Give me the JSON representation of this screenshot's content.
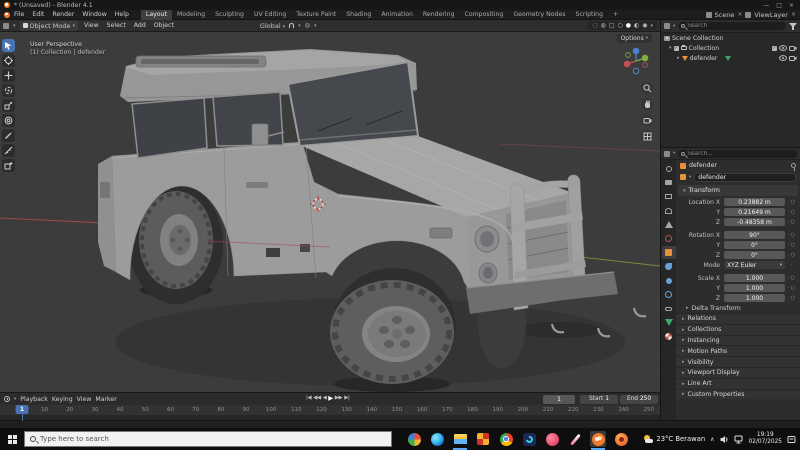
{
  "colors": {
    "accent": "#4772b3",
    "object_orange": "#e8913a",
    "data_green": "#3fa66f",
    "axis_x": "#a84a4f",
    "axis_y": "#7f9b39"
  },
  "window": {
    "title": "* (Unsaved) - Blender 4.1"
  },
  "topbar": {
    "menus": [
      "File",
      "Edit",
      "Render",
      "Window",
      "Help"
    ],
    "workspaces": [
      "Layout",
      "Modeling",
      "Sculpting",
      "UV Editing",
      "Texture Paint",
      "Shading",
      "Animation",
      "Rendering",
      "Compositing",
      "Geometry Nodes",
      "Scripting",
      "+"
    ],
    "scene_label": "Scene",
    "view_layer_label": "ViewLayer"
  },
  "tool_header": {
    "mode": "Object Mode",
    "menus": [
      "View",
      "Select",
      "Add",
      "Object"
    ],
    "orientation": "Global"
  },
  "viewport": {
    "overlay_line1": "User Perspective",
    "overlay_line2": "(1) Collection | defender",
    "options_label": "Options"
  },
  "outliner": {
    "search_placeholder": "Search",
    "rows": [
      {
        "label": "Scene Collection"
      },
      {
        "label": "Collection"
      },
      {
        "label": "defender"
      }
    ]
  },
  "properties": {
    "search_placeholder": "Search...",
    "breadcrumb_object": "defender",
    "name_value": "defender",
    "transform_title": "Transform",
    "rows": [
      {
        "label": "Location X",
        "value": "0.23882 m"
      },
      {
        "label": "Y",
        "value": "0.21649 m"
      },
      {
        "label": "Z",
        "value": "-0.48358 m"
      },
      {
        "label": "Rotation X",
        "value": "90°"
      },
      {
        "label": "Y",
        "value": "0°"
      },
      {
        "label": "Z",
        "value": "0°"
      },
      {
        "label": "Mode",
        "value": "XYZ Euler"
      },
      {
        "label": "Scale X",
        "value": "1.000"
      },
      {
        "label": "Y",
        "value": "1.000"
      },
      {
        "label": "Z",
        "value": "1.000"
      }
    ],
    "subsection": "Delta Transform",
    "sections": [
      "Relations",
      "Collections",
      "Instancing",
      "Motion Paths",
      "Visibility",
      "Viewport Display",
      "Line Art",
      "Custom Properties"
    ]
  },
  "timeline": {
    "menus": [
      "Playback",
      "Keying",
      "View",
      "Marker"
    ],
    "current_frame": "1",
    "start_label": "Start",
    "start_value": "1",
    "end_label": "End",
    "end_value": "250",
    "ticks": [
      1,
      10,
      20,
      30,
      40,
      50,
      60,
      70,
      80,
      90,
      100,
      110,
      120,
      130,
      140,
      150,
      160,
      170,
      180,
      190,
      200,
      210,
      220,
      230,
      240,
      250
    ]
  },
  "taskbar": {
    "search_placeholder": "Type here to search",
    "tray": {
      "weather": "23°C Berawan",
      "time": "19:19",
      "date": "02/07/2025"
    }
  }
}
